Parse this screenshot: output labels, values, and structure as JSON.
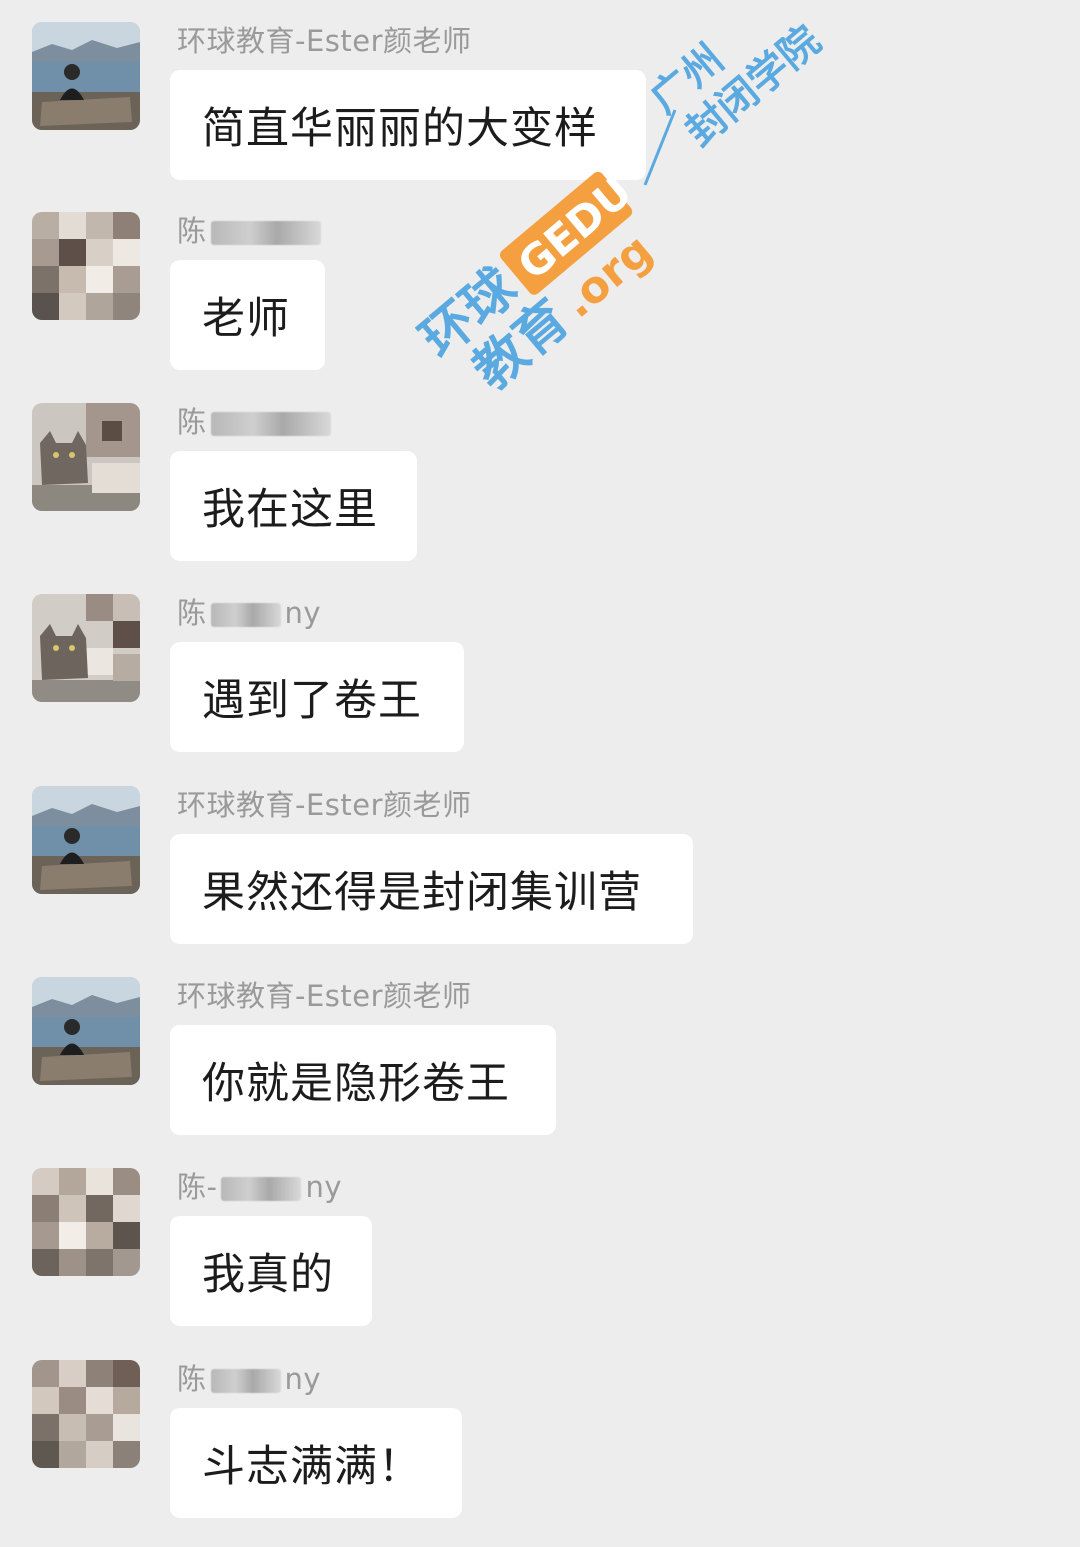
{
  "messages": [
    {
      "sender": "环球教育-Ester颜老师",
      "sender_blurred": false,
      "text": "简直华丽丽的大变样",
      "avatar": "teacher-photo"
    },
    {
      "sender": "陈",
      "sender_blurred": true,
      "sender_suffix": "",
      "text": "老师",
      "avatar": "pixelated-photo"
    },
    {
      "sender": "陈",
      "sender_blurred": true,
      "sender_suffix": "",
      "text": "我在这里",
      "avatar": "cat-photo"
    },
    {
      "sender": "陈",
      "sender_blurred": true,
      "sender_suffix": "ny",
      "text": "遇到了卷王",
      "avatar": "cat-photo"
    },
    {
      "sender": "环球教育-Ester颜老师",
      "sender_blurred": false,
      "text": "果然还得是封闭集训营",
      "avatar": "teacher-photo"
    },
    {
      "sender": "环球教育-Ester颜老师",
      "sender_blurred": false,
      "text": "你就是隐形卷王",
      "avatar": "teacher-photo"
    },
    {
      "sender": "陈-",
      "sender_blurred": true,
      "sender_suffix": "ny",
      "text": "我真的",
      "avatar": "pixelated-photo"
    },
    {
      "sender": "陈",
      "sender_blurred": true,
      "sender_suffix": "ny",
      "text": "斗志满满！",
      "avatar": "pixelated-photo"
    }
  ],
  "watermark": {
    "brand_line1": "环球",
    "brand_line2": "教育",
    "badge": "GEDU",
    "domain": ".org",
    "campus_line1": "广州",
    "campus_line2": "封闭学院",
    "color": "#5aa9e0",
    "badge_color": "#f4a040"
  }
}
